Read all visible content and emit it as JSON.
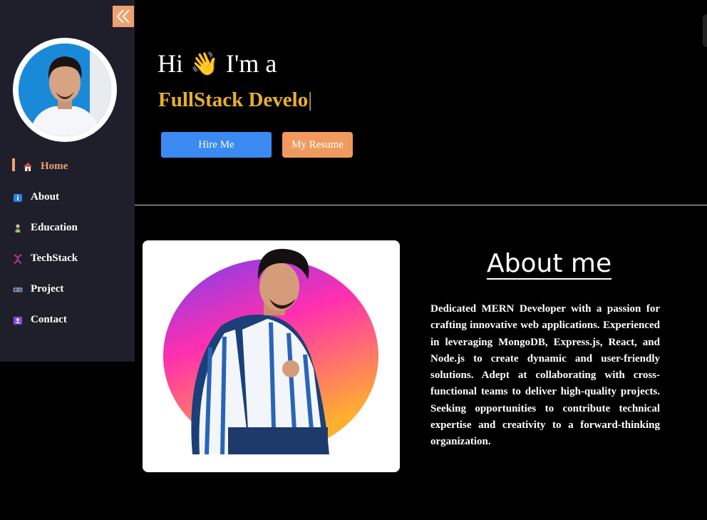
{
  "sidebar": {
    "collapse_icon": "double-chevron-left-icon",
    "items": [
      {
        "label": "Home",
        "icon": "house-icon",
        "active": true
      },
      {
        "label": "About",
        "icon": "info-icon",
        "active": false
      },
      {
        "label": "Education",
        "icon": "student-icon",
        "active": false
      },
      {
        "label": "TechStack",
        "icon": "dna-icon",
        "active": false
      },
      {
        "label": "Project",
        "icon": "game-controller-icon",
        "active": false
      },
      {
        "label": "Contact",
        "icon": "contact-card-icon",
        "active": false
      }
    ]
  },
  "hero": {
    "greet_before": "Hi",
    "wave": "👋",
    "greet_after": "I'm a",
    "role": "FullStack Develo",
    "caret": "|",
    "hire_label": "Hire Me",
    "resume_label": "My Resume"
  },
  "about": {
    "title": "About me",
    "text": "Dedicated MERN Developer with a passion for crafting innovative web applications. Experienced in leveraging MongoDB, Express.js, React, and Node.js to create dynamic and user-friendly solutions. Adept at collaborating with cross-functional teams to deliver high-quality projects. Seeking opportunities to contribute technical expertise and creativity to a forward-thinking organization."
  },
  "colors": {
    "accent": "#f0a070",
    "role": "#e8b12a",
    "primary_button": "#3b8af2",
    "sidebar_bg": "#1f1f2b"
  }
}
